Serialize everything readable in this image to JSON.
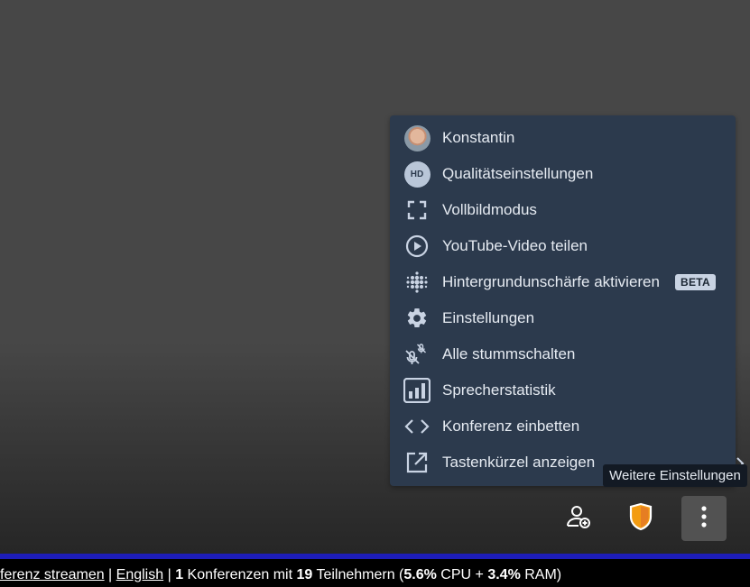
{
  "menu": {
    "items": [
      {
        "label": "Konstantin",
        "icon": "avatar-icon"
      },
      {
        "label": "Qualitätseinstellungen",
        "icon": "hd-icon",
        "icon_text": "HD"
      },
      {
        "label": "Vollbildmodus",
        "icon": "fullscreen-icon"
      },
      {
        "label": "YouTube-Video teilen",
        "icon": "play-icon"
      },
      {
        "label": "Hintergrundunschärfe aktivieren",
        "icon": "blur-icon",
        "badge": "BETA"
      },
      {
        "label": "Einstellungen",
        "icon": "gear-icon"
      },
      {
        "label": "Alle stummschalten",
        "icon": "mute-all-icon"
      },
      {
        "label": "Sprecherstatistik",
        "icon": "speaker-stats-icon"
      },
      {
        "label": "Konferenz einbetten",
        "icon": "embed-icon"
      },
      {
        "label": "Tastenkürzel anzeigen",
        "icon": "external-link-icon"
      }
    ]
  },
  "tooltip": "Weitere Einstellungen",
  "toolbar": {
    "invite_icon": "add-participant-icon",
    "security_icon": "shield-icon",
    "more_icon": "more-vertical-icon"
  },
  "status": {
    "link1": "ferenz streamen",
    "sep1": " | ",
    "link2": "English",
    "sep2": " | ",
    "conf_count": "1",
    "text1": " Konferenzen mit ",
    "participants": "19",
    "text2": " Teilnehmern (",
    "cpu": "5.6%",
    "text3": " CPU + ",
    "ram": "3.4%",
    "text4": " RAM)"
  },
  "colors": {
    "menu_bg": "#2c3a4d",
    "shield": "#f39c12",
    "status_bar_accent": "#1d1db8"
  }
}
